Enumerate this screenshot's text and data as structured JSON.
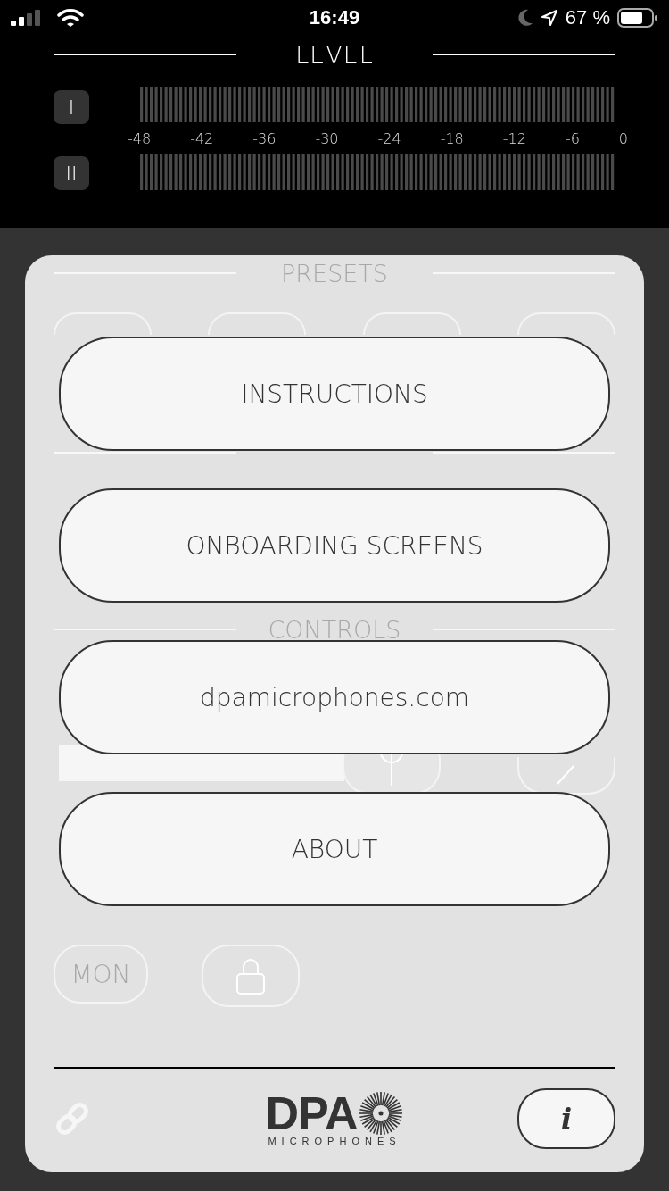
{
  "status_bar": {
    "time": "16:49",
    "battery": "67 %"
  },
  "level": {
    "title": "LEVEL",
    "channels": [
      "I",
      "II"
    ],
    "scale": [
      "-48",
      "-42",
      "-36",
      "-30",
      "-24",
      "-18",
      "-12",
      "-6",
      "0"
    ]
  },
  "panel": {
    "sections": [
      "PRESETS",
      "CONTROLS"
    ],
    "mon_button": "MON"
  },
  "menu": {
    "items": [
      "INSTRUCTIONS",
      "ONBOARDING SCREENS",
      "dpamicrophones.com",
      "ABOUT"
    ]
  },
  "footer": {
    "logo": "DPA",
    "logo_subtitle": "MICROPHONES",
    "info_button": "i"
  }
}
